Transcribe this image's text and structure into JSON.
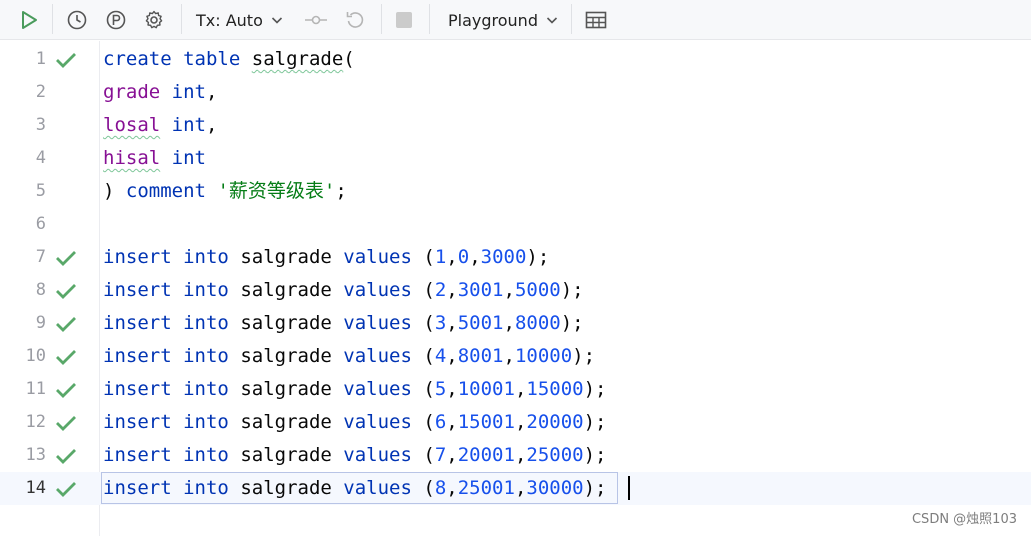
{
  "toolbar": {
    "tx_label": "Tx: Auto",
    "playground_label": "Playground",
    "icons": [
      "run-icon",
      "history-icon",
      "parking-icon",
      "gear-icon",
      "chevron-down-icon",
      "commit-icon",
      "rollback-icon",
      "stop-icon",
      "table-view-icon"
    ]
  },
  "colors": {
    "keyword": "#0033b3",
    "column": "#871094",
    "number": "#1750eb",
    "string": "#067d17",
    "check": "#59a869"
  },
  "editor": {
    "line_numbers": [
      "1",
      "2",
      "3",
      "4",
      "5",
      "6",
      "7",
      "8",
      "9",
      "10",
      "11",
      "12",
      "13",
      "14"
    ],
    "lines": [
      {
        "t1": "create",
        "t2": "table",
        "t3": "salgrade",
        "t4": "("
      },
      {
        "t1": "grade",
        "t2": "int",
        "t3": ","
      },
      {
        "t1": "losal",
        "t2": "int",
        "t3": ","
      },
      {
        "t1": "hisal",
        "t2": "int"
      },
      {
        "t1": ")",
        "t2": "comment",
        "t3": "'薪资等级表'",
        "t4": ";"
      },
      {},
      {
        "kw1": "insert",
        "kw2": "into",
        "tbl": "salgrade",
        "kw3": "values",
        "p1": "(",
        "n1": "1",
        "c1": ",",
        "n2": "0",
        "c2": ",",
        "n3": "3000",
        "p2": ");"
      },
      {
        "kw1": "insert",
        "kw2": "into",
        "tbl": "salgrade",
        "kw3": "values",
        "p1": "(",
        "n1": "2",
        "c1": ",",
        "n2": "3001",
        "c2": ",",
        "n3": "5000",
        "p2": ");"
      },
      {
        "kw1": "insert",
        "kw2": "into",
        "tbl": "salgrade",
        "kw3": "values",
        "p1": "(",
        "n1": "3",
        "c1": ",",
        "n2": "5001",
        "c2": ",",
        "n3": "8000",
        "p2": ");"
      },
      {
        "kw1": "insert",
        "kw2": "into",
        "tbl": "salgrade",
        "kw3": "values",
        "p1": "(",
        "n1": "4",
        "c1": ",",
        "n2": "8001",
        "c2": ",",
        "n3": "10000",
        "p2": ");"
      },
      {
        "kw1": "insert",
        "kw2": "into",
        "tbl": "salgrade",
        "kw3": "values",
        "p1": "(",
        "n1": "5",
        "c1": ",",
        "n2": "10001",
        "c2": ",",
        "n3": "15000",
        "p2": ");"
      },
      {
        "kw1": "insert",
        "kw2": "into",
        "tbl": "salgrade",
        "kw3": "values",
        "p1": "(",
        "n1": "6",
        "c1": ",",
        "n2": "15001",
        "c2": ",",
        "n3": "20000",
        "p2": ");"
      },
      {
        "kw1": "insert",
        "kw2": "into",
        "tbl": "salgrade",
        "kw3": "values",
        "p1": "(",
        "n1": "7",
        "c1": ",",
        "n2": "20001",
        "c2": ",",
        "n3": "25000",
        "p2": ");"
      },
      {
        "kw1": "insert",
        "kw2": "into",
        "tbl": "salgrade",
        "kw3": "values",
        "p1": "(",
        "n1": "8",
        "c1": ",",
        "n2": "25001",
        "c2": ",",
        "n3": "30000",
        "p2": ");"
      }
    ]
  },
  "watermark": "CSDN @烛照103"
}
